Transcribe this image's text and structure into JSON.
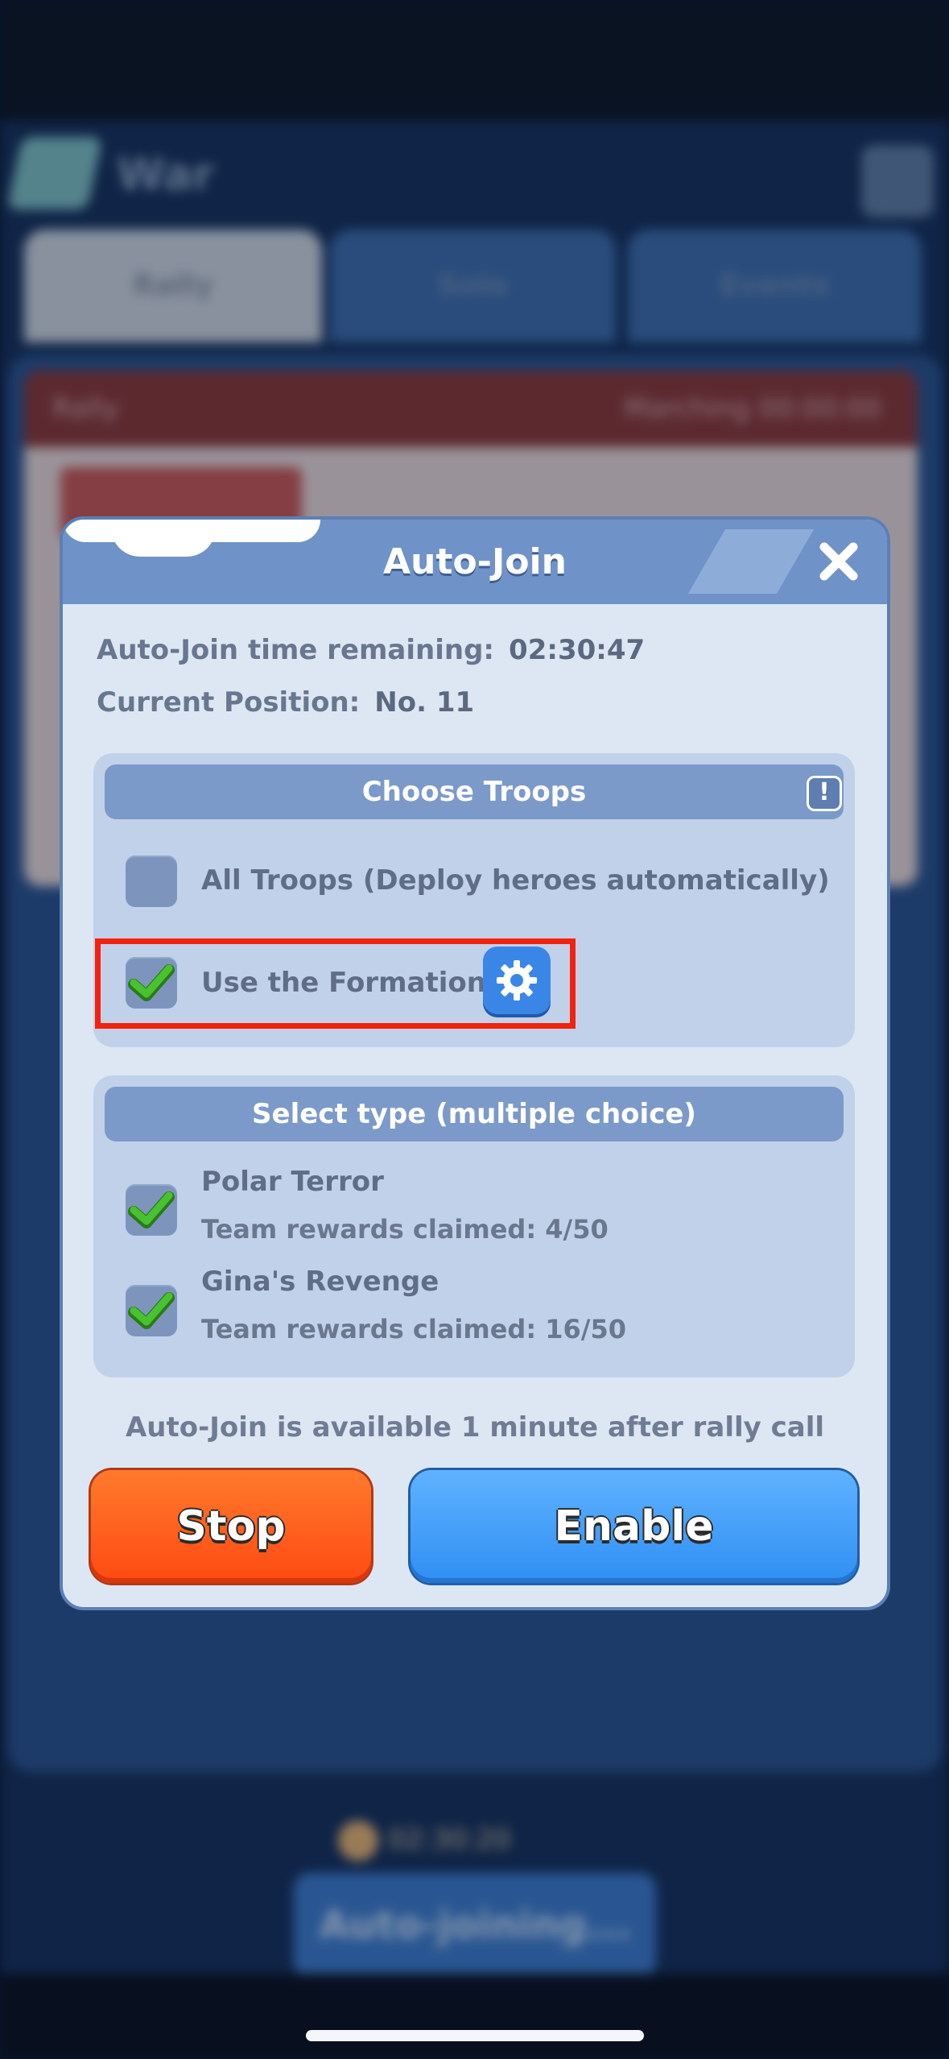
{
  "background": {
    "title": "War",
    "tabs": [
      "Rally",
      "Solo",
      "Events"
    ],
    "card_header_left": "Rally",
    "card_header_right": "Marching 00:00:00",
    "bottom_timer": "02:30:20",
    "auto_join_button": "Auto-joining..."
  },
  "modal": {
    "title": "Auto-Join",
    "close_icon": "close-x-icon",
    "time_remaining_label": "Auto-Join time remaining:",
    "time_remaining_value": "02:30:47",
    "position_label": "Current Position:",
    "position_value": "No. 11",
    "choose_troops": {
      "header": "Choose Troops",
      "info_icon": "!",
      "options": [
        {
          "label": "All Troops (Deploy heroes automatically)",
          "checked": false
        },
        {
          "label": "Use the Formation",
          "checked": true
        }
      ],
      "formation_settings_icon": "gear-icon"
    },
    "select_type": {
      "header": "Select type (multiple choice)",
      "options": [
        {
          "label": "Polar Terror",
          "sub": "Team rewards claimed: 4/50",
          "checked": true
        },
        {
          "label": "Gina's Revenge",
          "sub": "Team rewards claimed: 16/50",
          "checked": true
        }
      ]
    },
    "footer_note": "Auto-Join is available 1 minute after rally call",
    "stop_label": "Stop",
    "enable_label": "Enable"
  },
  "colors": {
    "highlight": "#f2220e",
    "stop_button": "#ff5a1a",
    "enable_button": "#3f9cf8",
    "check_green": "#3fbf2a"
  }
}
